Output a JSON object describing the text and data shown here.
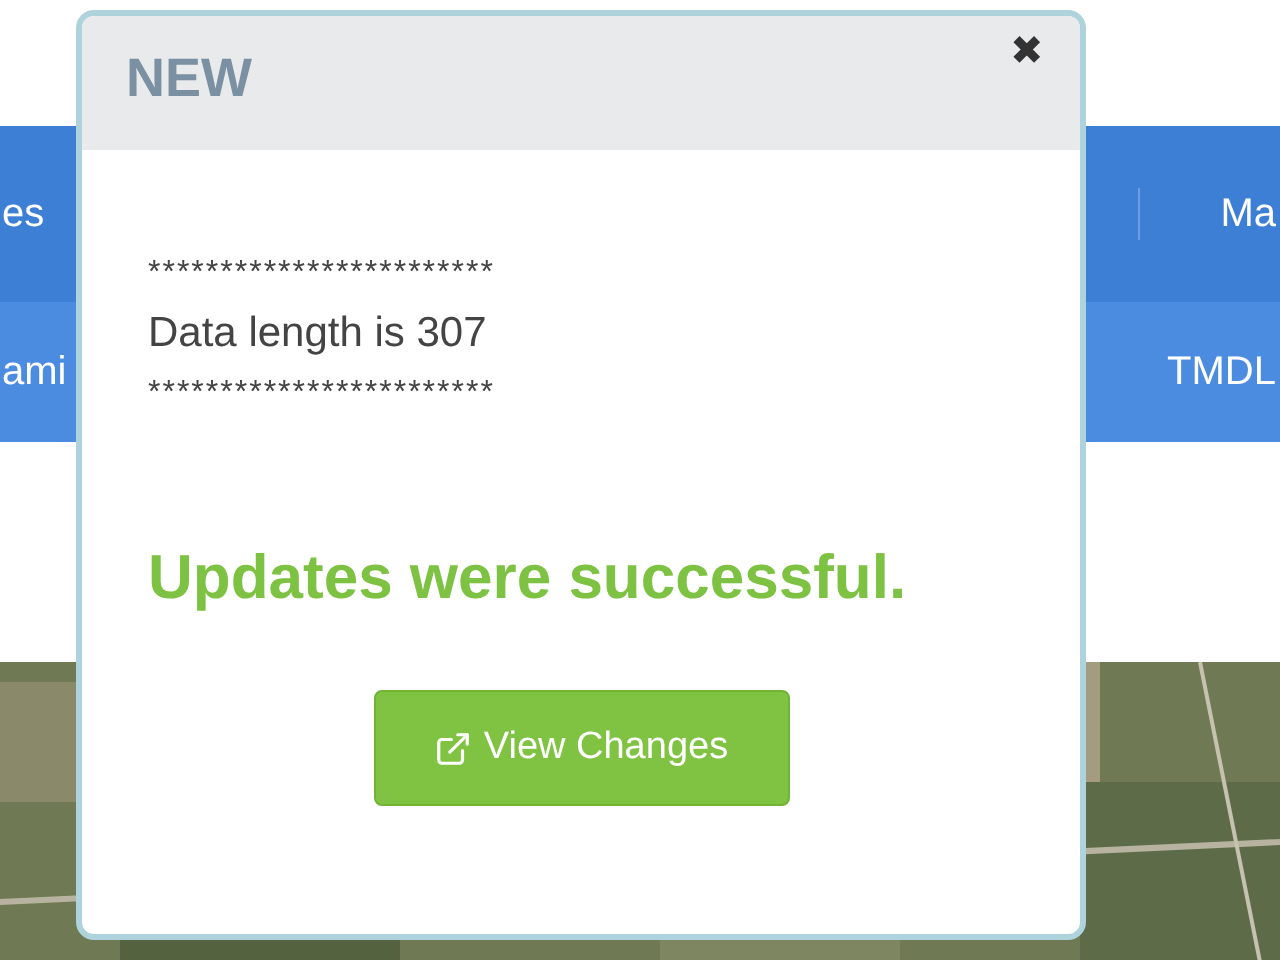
{
  "nav": {
    "rows": [
      {
        "left": "es",
        "right": "Ma"
      },
      {
        "left": "ami",
        "right": "TMDL"
      }
    ]
  },
  "modal": {
    "title": "NEW",
    "close": "✖",
    "lines": [
      "************************",
      "Data length is 307",
      "************************"
    ],
    "message": "Updates were successful.",
    "button": "View Changes"
  }
}
